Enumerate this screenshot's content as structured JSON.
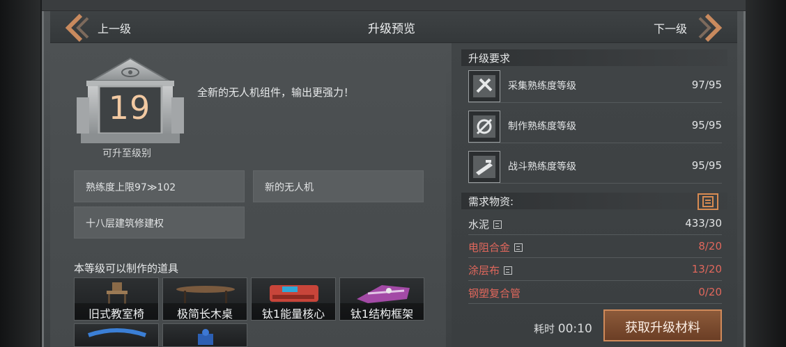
{
  "header": {
    "title": "升级预览",
    "prev_label": "上一级",
    "next_label": "下一级"
  },
  "level": {
    "value": "19",
    "caption": "可升至级别",
    "description": "全新的无人机组件，输出更强力！"
  },
  "unlocks": [
    "熟练度上限97≫102",
    "新的无人机",
    "十八层建筑修建权"
  ],
  "craftables": {
    "title": "本等级可以制作的道具",
    "items": [
      "旧式教室椅",
      "极简长木桌",
      "钛1能量核心",
      "钛1结构框架"
    ]
  },
  "requirements": {
    "title": "升级要求",
    "rows": [
      {
        "name": "采集熟练度等级",
        "value": "97/95",
        "icon": "gather-skill-icon"
      },
      {
        "name": "制作熟练度等级",
        "value": "95/95",
        "icon": "craft-skill-icon"
      },
      {
        "name": "战斗熟练度等级",
        "value": "95/95",
        "icon": "combat-skill-icon"
      }
    ]
  },
  "materials": {
    "title": "需求物资:",
    "rows": [
      {
        "name": "水泥",
        "value": "433/30",
        "status": "ok",
        "has_box": true
      },
      {
        "name": "电阻合金",
        "value": "8/20",
        "status": "short",
        "has_box": true
      },
      {
        "name": "涂层布",
        "value": "13/20",
        "status": "short",
        "has_box": true
      },
      {
        "name": "钢塑复合管",
        "value": "0/20",
        "status": "short",
        "has_box": false
      }
    ]
  },
  "footer": {
    "time_label": "耗时",
    "time_value": "00:10",
    "acquire_button": "获取升级材料"
  },
  "colors": {
    "accent": "#d08a5a",
    "level_number": "#f2c9a2",
    "shortage": "#e0675c"
  }
}
